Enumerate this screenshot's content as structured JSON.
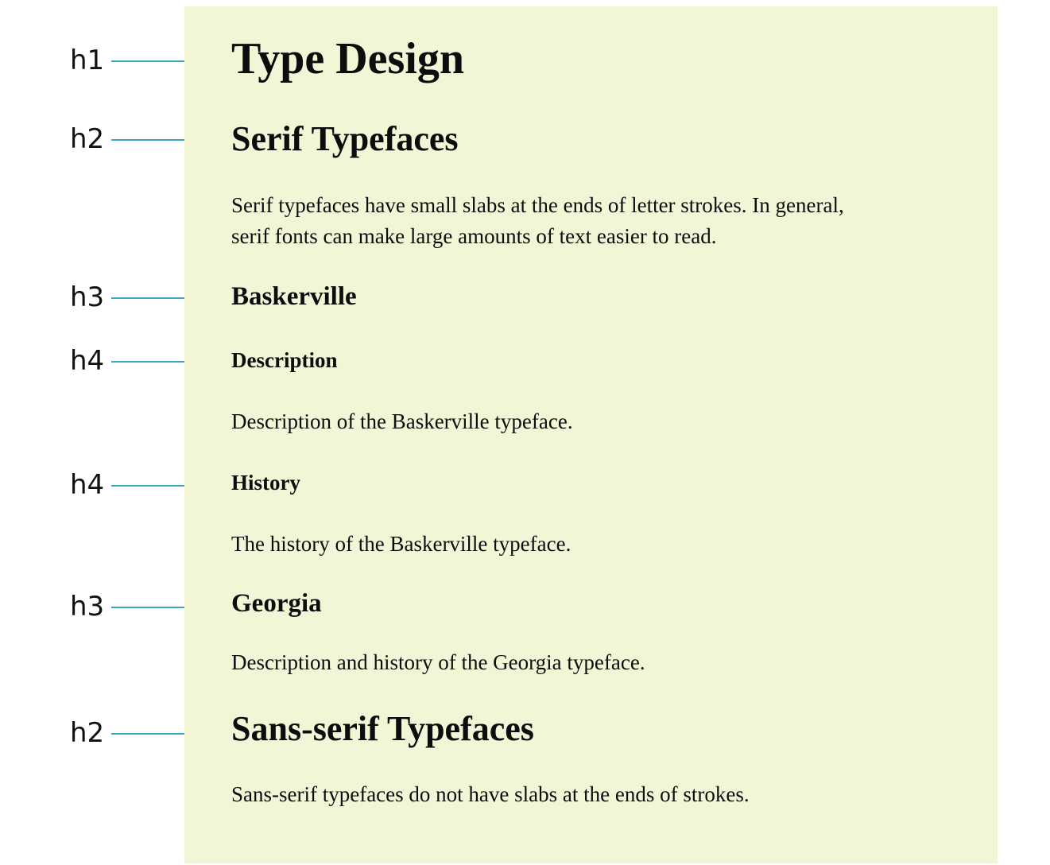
{
  "annotations": [
    {
      "label": "h1"
    },
    {
      "label": "h2"
    },
    {
      "label": "h3"
    },
    {
      "label": "h4"
    },
    {
      "label": "h4"
    },
    {
      "label": "h3"
    },
    {
      "label": "h2"
    }
  ],
  "document": {
    "title": "Type Design",
    "serif": {
      "heading": "Serif Typefaces",
      "intro_line1": "Serif typefaces have small slabs at the ends of letter strokes.  In general,",
      "intro_line2": "serif fonts can make large amounts of text easier to read.",
      "baskerville": {
        "heading": "Baskerville",
        "description_heading": "Description",
        "description_text": "Description of the Baskerville typeface.",
        "history_heading": "History",
        "history_text": "The history of the Baskerville typeface."
      },
      "georgia": {
        "heading": "Georgia",
        "text": "Description and history of the Georgia typeface."
      }
    },
    "sans_serif": {
      "heading": "Sans-serif Typefaces",
      "text": "Sans-serif typefaces do not have slabs at the ends of strokes."
    }
  },
  "colors": {
    "panel_background": "#f2f5d6",
    "connector_line": "#3fa5c8",
    "text": "#0d0d0d"
  }
}
